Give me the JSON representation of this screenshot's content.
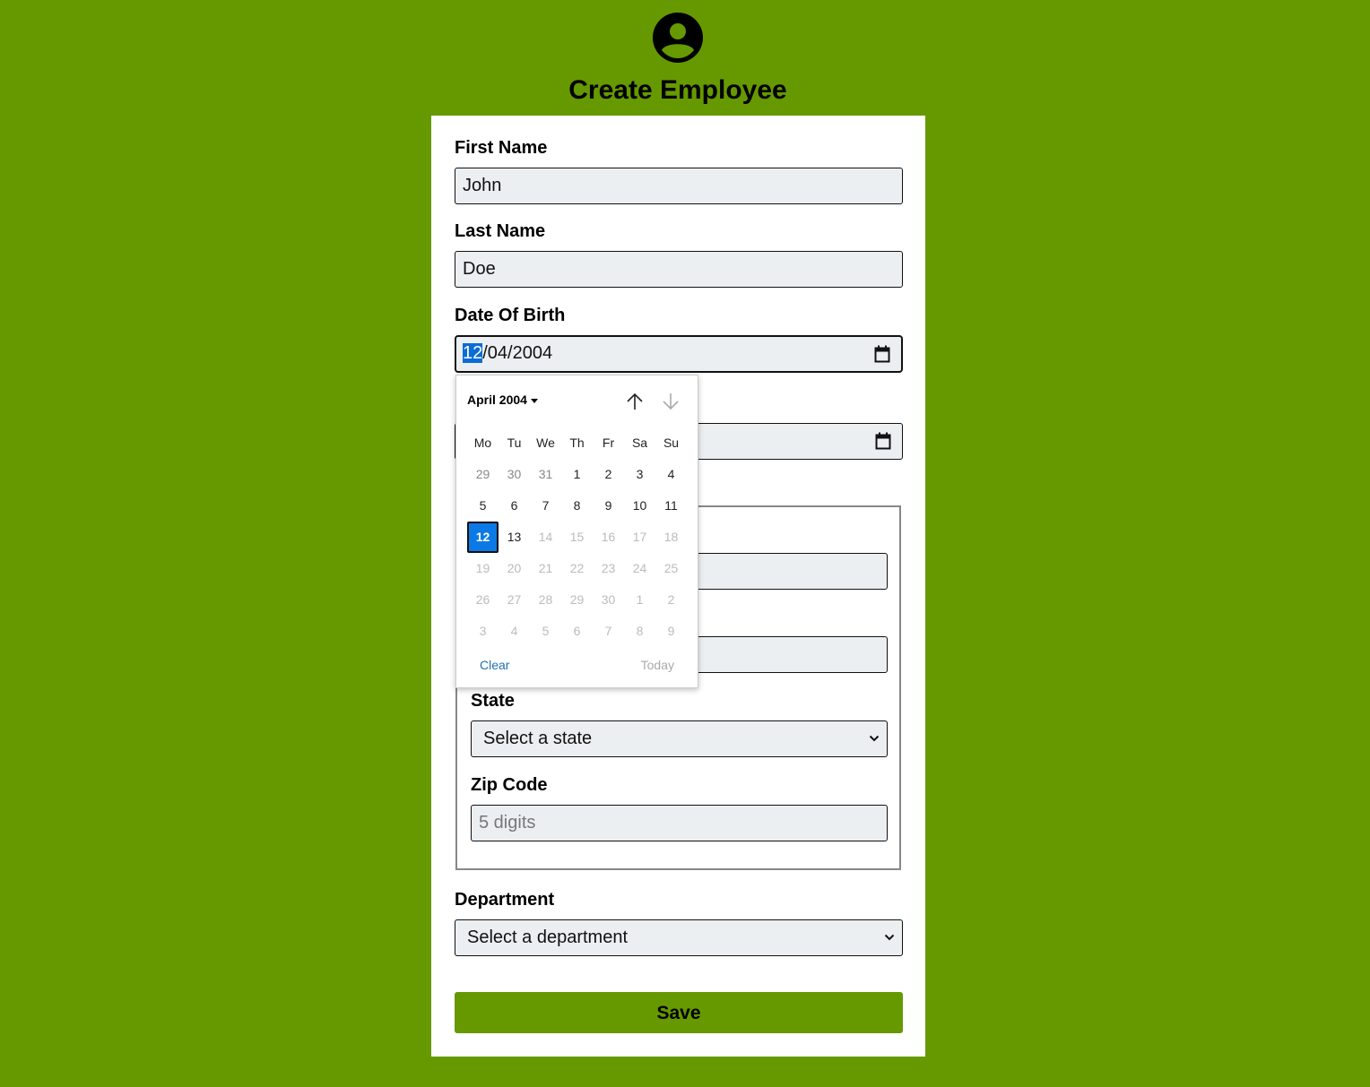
{
  "header": {
    "title": "Create Employee",
    "icon": "account-circle-icon"
  },
  "form": {
    "first_name": {
      "label": "First Name",
      "value": "John"
    },
    "last_name": {
      "label": "Last Name",
      "value": "Doe"
    },
    "date_of_birth": {
      "label": "Date Of Birth",
      "value_day_selected": "12",
      "value_rest": "/04/2004"
    },
    "state": {
      "label": "State",
      "value": "Select a state"
    },
    "zip": {
      "label": "Zip Code",
      "placeholder": "5 digits"
    },
    "department": {
      "label": "Department",
      "value": "Select a department"
    },
    "save_label": "Save"
  },
  "datepicker": {
    "month_label": "April 2004",
    "weekdays": [
      "Mo",
      "Tu",
      "We",
      "Th",
      "Fr",
      "Sa",
      "Su"
    ],
    "weeks": [
      [
        {
          "d": "29",
          "s": "other"
        },
        {
          "d": "30",
          "s": "other"
        },
        {
          "d": "31",
          "s": "other"
        },
        {
          "d": "1",
          "s": "normal"
        },
        {
          "d": "2",
          "s": "normal"
        },
        {
          "d": "3",
          "s": "normal"
        },
        {
          "d": "4",
          "s": "normal"
        }
      ],
      [
        {
          "d": "5",
          "s": "normal"
        },
        {
          "d": "6",
          "s": "normal"
        },
        {
          "d": "7",
          "s": "normal"
        },
        {
          "d": "8",
          "s": "normal"
        },
        {
          "d": "9",
          "s": "normal"
        },
        {
          "d": "10",
          "s": "normal"
        },
        {
          "d": "11",
          "s": "normal"
        }
      ],
      [
        {
          "d": "12",
          "s": "selected"
        },
        {
          "d": "13",
          "s": "normal"
        },
        {
          "d": "14",
          "s": "disabled"
        },
        {
          "d": "15",
          "s": "disabled"
        },
        {
          "d": "16",
          "s": "disabled"
        },
        {
          "d": "17",
          "s": "disabled"
        },
        {
          "d": "18",
          "s": "disabled"
        }
      ],
      [
        {
          "d": "19",
          "s": "disabled"
        },
        {
          "d": "20",
          "s": "disabled"
        },
        {
          "d": "21",
          "s": "disabled"
        },
        {
          "d": "22",
          "s": "disabled"
        },
        {
          "d": "23",
          "s": "disabled"
        },
        {
          "d": "24",
          "s": "disabled"
        },
        {
          "d": "25",
          "s": "disabled"
        }
      ],
      [
        {
          "d": "26",
          "s": "disabled"
        },
        {
          "d": "27",
          "s": "disabled"
        },
        {
          "d": "28",
          "s": "disabled"
        },
        {
          "d": "29",
          "s": "disabled"
        },
        {
          "d": "30",
          "s": "disabled"
        },
        {
          "d": "1",
          "s": "disabled"
        },
        {
          "d": "2",
          "s": "disabled"
        }
      ],
      [
        {
          "d": "3",
          "s": "disabled"
        },
        {
          "d": "4",
          "s": "disabled"
        },
        {
          "d": "5",
          "s": "disabled"
        },
        {
          "d": "6",
          "s": "disabled"
        },
        {
          "d": "7",
          "s": "disabled"
        },
        {
          "d": "8",
          "s": "disabled"
        },
        {
          "d": "9",
          "s": "disabled"
        }
      ]
    ],
    "clear_label": "Clear",
    "today_label": "Today"
  },
  "colors": {
    "background": "#669900",
    "selected_day": "#0b7ae6",
    "link": "#1f6fb5"
  }
}
